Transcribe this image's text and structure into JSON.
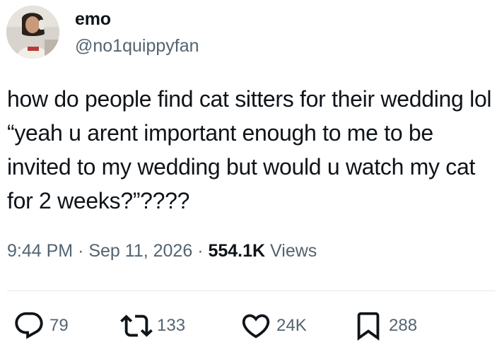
{
  "author": {
    "display_name": "emo",
    "handle": "@no1quippyfan"
  },
  "tweet": {
    "text": "how do people find cat sitters for their wedding lol “yeah u arent important enough to me to be invited to my wedding but would u watch my cat for 2 weeks?”????",
    "time": "9:44 PM",
    "date": "Sep 11, 2026",
    "separator": "·",
    "views_count": "554.1K",
    "views_label": "Views"
  },
  "actions": {
    "replies": "79",
    "reposts": "133",
    "likes": "24K",
    "bookmarks": "288"
  },
  "icons": {
    "reply": "reply-icon",
    "repost": "repost-icon",
    "like": "heart-icon",
    "bookmark": "bookmark-icon"
  },
  "colors": {
    "text": "#0f1419",
    "secondary": "#536471",
    "divider": "#e6e9eb"
  }
}
